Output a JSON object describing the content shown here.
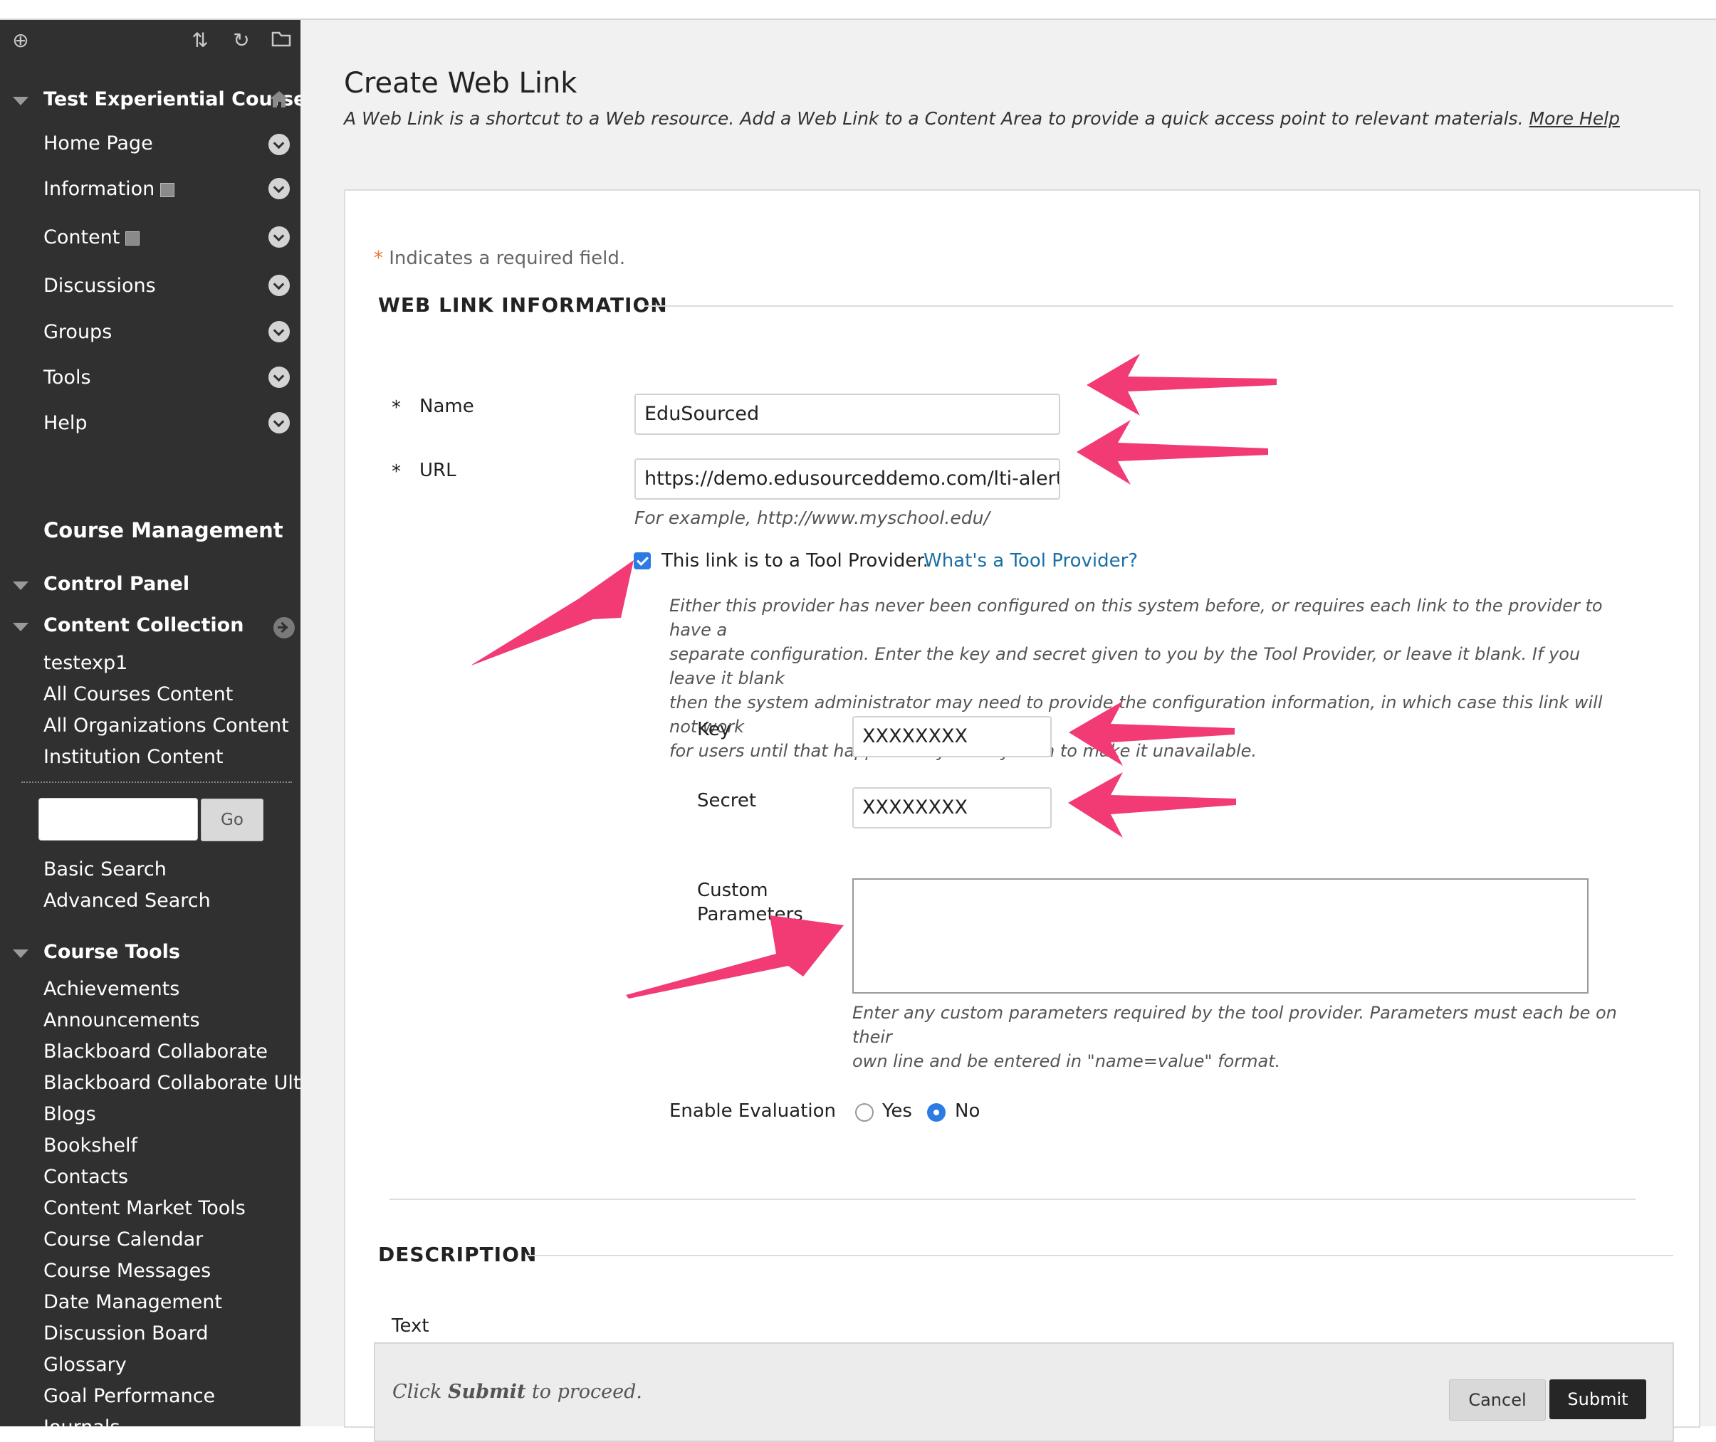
{
  "sidebar": {
    "course_title": "Test Experiential Course",
    "menu_items": [
      {
        "label": "Home Page"
      },
      {
        "label": "Information"
      },
      {
        "label": "Content"
      },
      {
        "label": "Discussions"
      },
      {
        "label": "Groups"
      },
      {
        "label": "Tools"
      },
      {
        "label": "Help"
      }
    ],
    "course_management": "Course Management",
    "control_panel": "Control Panel",
    "content_collection": {
      "title": "Content Collection",
      "links": [
        "testexp1",
        "All Courses Content",
        "All Organizations Content",
        "Institution Content"
      ]
    },
    "search": {
      "placeholder": "",
      "go_label": "Go",
      "basic": "Basic Search",
      "advanced": "Advanced Search"
    },
    "course_tools": {
      "title": "Course Tools",
      "items": [
        "Achievements",
        "Announcements",
        "Blackboard Collaborate",
        "Blackboard Collaborate Ultra",
        "Blogs",
        "Bookshelf",
        "Contacts",
        "Content Market Tools",
        "Course Calendar",
        "Course Messages",
        "Date Management",
        "Discussion Board",
        "Glossary",
        "Goal Performance",
        "Journals"
      ]
    }
  },
  "page": {
    "title": "Create Web Link",
    "description": "A Web Link is a shortcut to a Web resource. Add a Web Link to a Content Area to provide a quick access point to relevant materials.",
    "more_help": "More Help"
  },
  "form": {
    "required_star": "*",
    "required_note": "Indicates a required field.",
    "section_info": "WEB LINK INFORMATION",
    "name_label": "Name",
    "name_value": "EduSourced",
    "url_label": "URL",
    "url_value": "https://demo.edusourceddemo.com/lti-alerts",
    "url_example": "For example, http://www.myschool.edu/",
    "tool_provider_checked": true,
    "tool_provider_label": "This link is to a Tool Provider.",
    "tool_provider_link": "What's a Tool Provider?",
    "tool_provider_help": [
      "Either this provider has never been configured on this system before, or requires each link to the provider to have a",
      "separate configuration. Enter the key and secret given to you by the Tool Provider, or leave it blank. If you leave it blank",
      "then the system administrator may need to provide the configuration information, in which case this link will not work",
      "for users until that happens so you may wish to make it unavailable."
    ],
    "key_label": "Key",
    "key_value": "XXXXXXXX",
    "secret_label": "Secret",
    "secret_value": "XXXXXXXX",
    "custom_label_1": "Custom",
    "custom_label_2": "Parameters",
    "custom_value": "",
    "custom_help": [
      "Enter any custom parameters required by the tool provider. Parameters must each be on their",
      "own line and be entered in \"name=value\" format."
    ],
    "evaluation_label": "Enable Evaluation",
    "evaluation_options": [
      "Yes",
      "No"
    ],
    "evaluation_selected": "No",
    "section_description": "DESCRIPTION",
    "text_label": "Text"
  },
  "submit_bar": {
    "note_prefix": "Click ",
    "note_bold": "Submit",
    "note_suffix": " to proceed.",
    "cancel": "Cancel",
    "submit": "Submit"
  },
  "colors": {
    "annotation_arrow": "#f23a74",
    "sidebar_bg": "#303030",
    "accent": "#2c7be5",
    "link": "#196fa6"
  }
}
